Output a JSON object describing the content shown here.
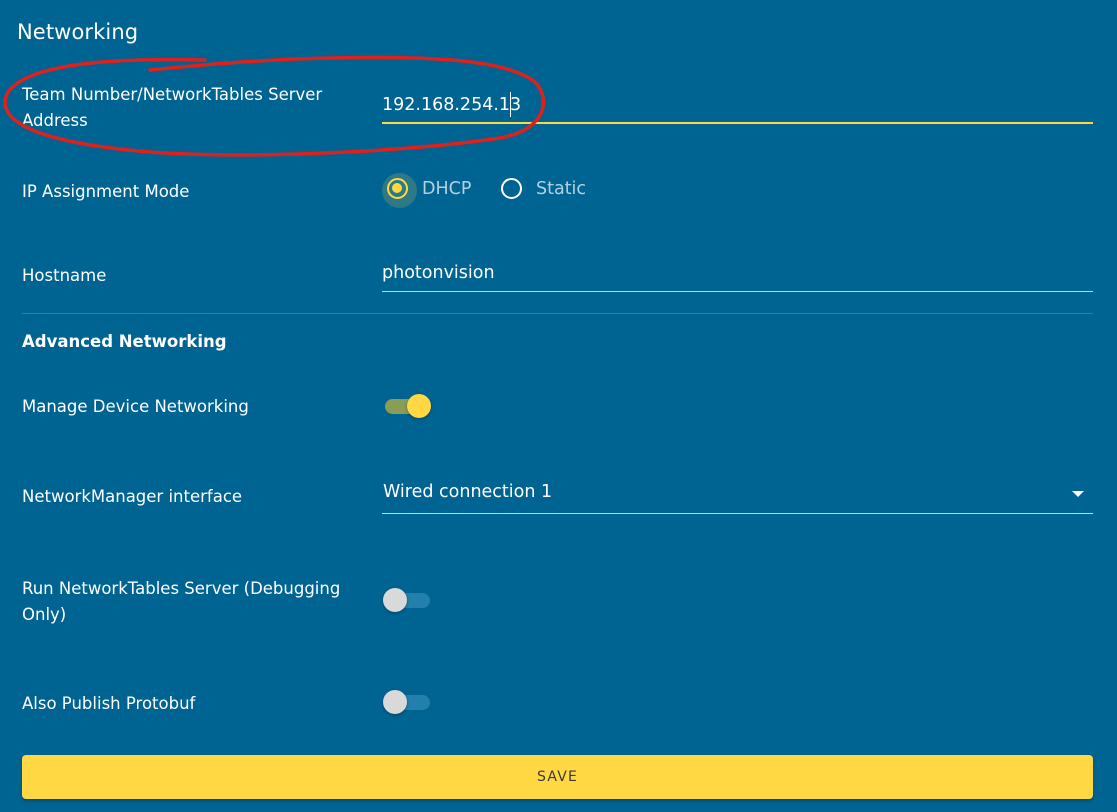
{
  "card": {
    "title": "Networking"
  },
  "fields": {
    "team_number": {
      "label_line1": "Team Number/NetworkTables Server",
      "label_line2": "Address",
      "value": "192.168.254.13"
    },
    "ip_mode": {
      "label": "IP Assignment Mode",
      "options": [
        "DHCP",
        "Static"
      ],
      "selected": "DHCP"
    },
    "hostname": {
      "label": "Hostname",
      "value": "photonvision"
    }
  },
  "advanced": {
    "heading": "Advanced Networking",
    "manage_device": {
      "label": "Manage Device Networking",
      "enabled": true
    },
    "nm_interface": {
      "label": "NetworkManager interface",
      "value": "Wired connection 1"
    },
    "run_nt_server": {
      "label_line1": "Run NetworkTables Server (Debugging",
      "label_line2": "Only)",
      "enabled": false
    },
    "publish_protobuf": {
      "label": "Also Publish Protobuf",
      "enabled": false
    }
  },
  "actions": {
    "save_label": "SAVE"
  },
  "colors": {
    "background": "#006492",
    "accent": "#ffd843",
    "annotation": "#e0201b"
  },
  "icons": {
    "dropdown": "chevron-down-icon"
  }
}
